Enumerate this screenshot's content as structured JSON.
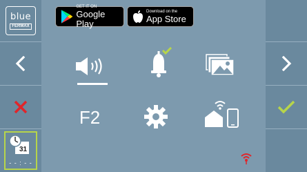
{
  "brand": {
    "logo_word": "blue",
    "logo_sub": "FERMAX"
  },
  "store_badges": {
    "google_play": {
      "small": "GET IT ON",
      "big": "Google Play"
    },
    "app_store": {
      "small": "Download on the",
      "big": "App Store"
    }
  },
  "menu": {
    "items": [
      {
        "id": "sound",
        "icon": "speaker-icon",
        "selected": true
      },
      {
        "id": "bell",
        "icon": "bell-icon",
        "checked": true
      },
      {
        "id": "gallery",
        "icon": "gallery-icon"
      },
      {
        "id": "f2",
        "label": "F2"
      },
      {
        "id": "settings",
        "icon": "gear-icon"
      },
      {
        "id": "wifi-home",
        "icon": "home-wifi-phone-icon"
      }
    ]
  },
  "nav": {
    "prev_icon": "chevron-left-icon",
    "next_icon": "chevron-right-icon",
    "cancel_icon": "close-icon",
    "ok_icon": "check-icon"
  },
  "datetime": {
    "calendar_day": "31",
    "time_text": "- - : - -"
  },
  "colors": {
    "background": "#7d9aae",
    "side_columns": "#6a899e",
    "accent_green": "#b7d54a",
    "cancel_red": "#e0252a",
    "wifi_red": "#e0252a"
  }
}
